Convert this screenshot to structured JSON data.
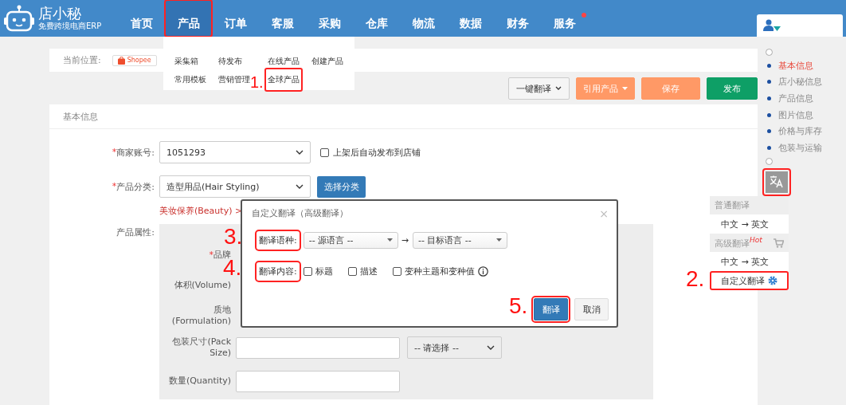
{
  "logo": {
    "name": "店小秘",
    "tagline": "免费跨境电商ERP"
  },
  "nav": [
    {
      "label": "首页",
      "selected": false,
      "highlighted": false,
      "badge": false
    },
    {
      "label": "产品",
      "selected": true,
      "highlighted": true,
      "badge": false
    },
    {
      "label": "订单",
      "selected": false,
      "highlighted": false,
      "badge": false
    },
    {
      "label": "客服",
      "selected": false,
      "highlighted": false,
      "badge": false
    },
    {
      "label": "采购",
      "selected": false,
      "highlighted": false,
      "badge": false
    },
    {
      "label": "仓库",
      "selected": false,
      "highlighted": false,
      "badge": false
    },
    {
      "label": "物流",
      "selected": false,
      "highlighted": false,
      "badge": false
    },
    {
      "label": "数据",
      "selected": false,
      "highlighted": false,
      "badge": false
    },
    {
      "label": "财务",
      "selected": false,
      "highlighted": false,
      "badge": false
    },
    {
      "label": "服务",
      "selected": false,
      "highlighted": false,
      "badge": true
    }
  ],
  "breadcrumb": {
    "label": "当前位置:",
    "platform": "Shopee"
  },
  "product_menu": {
    "rows": [
      [
        {
          "label": "采集箱",
          "highlighted": false
        },
        {
          "label": "待发布",
          "highlighted": false
        },
        {
          "label": "在线产品",
          "highlighted": false
        },
        {
          "label": "创建产品",
          "highlighted": false
        }
      ],
      [
        {
          "label": "常用模板",
          "highlighted": false
        },
        {
          "label": "营销管理",
          "highlighted": false
        },
        {
          "label": "全球产品",
          "highlighted": true
        }
      ]
    ]
  },
  "toolbar": [
    {
      "label": "一键翻译",
      "kind": "menu"
    },
    {
      "label": "引用产品",
      "kind": "orange-menu"
    },
    {
      "label": "保存",
      "kind": "orange"
    },
    {
      "label": "发布",
      "kind": "green"
    }
  ],
  "section": {
    "title": "基本信息"
  },
  "merchant_account": {
    "required_mark": "*",
    "label": "商家账号:",
    "value": "1051293",
    "auto_publish": {
      "label": "上架后自动发布到店铺",
      "checked": false
    }
  },
  "category": {
    "required_mark": "*",
    "label": "产品分类:",
    "value": "造型用品(Hair Styling)",
    "button": "选择分类",
    "path": "美妆保养(Beauty) >"
  },
  "attributes": {
    "label": "产品属性:",
    "rows": [
      {
        "required_mark": "*",
        "label": "品牌",
        "kind": "covered"
      },
      {
        "required_mark": "",
        "label": "体积(Volume)",
        "kind": "covered"
      },
      {
        "required_mark": "",
        "label": "质地 (Formulation)",
        "kind": "covered"
      },
      {
        "required_mark": "",
        "label": "包装尺寸(Pack Size)",
        "kind": "input-unit",
        "unit_placeholder": "-- 请选择 --"
      },
      {
        "required_mark": "",
        "label": "数量(Quantity)",
        "kind": "input"
      }
    ]
  },
  "anchor_nav": [
    {
      "label": "基本信息",
      "selected": true
    },
    {
      "label": "店小秘信息",
      "selected": false
    },
    {
      "label": "产品信息",
      "selected": false
    },
    {
      "label": "图片信息",
      "selected": false
    },
    {
      "label": "价格与库存",
      "selected": false
    },
    {
      "label": "包装与运输",
      "selected": false
    }
  ],
  "translate_button": {
    "highlighted": true
  },
  "translate_menu": [
    {
      "title": "普通翻译",
      "cart": false,
      "items": [
        {
          "label": "中文 → 英文",
          "settings": false,
          "highlighted": false
        }
      ]
    },
    {
      "title": "高级翻译",
      "hot": "Hot",
      "cart": true,
      "items": [
        {
          "label": "中文 → 英文",
          "settings": false,
          "highlighted": false
        },
        {
          "label": "自定义翻译",
          "settings": true,
          "highlighted": true
        }
      ]
    }
  ],
  "dialog": {
    "title": "自定义翻译（高级翻译）",
    "close": "×",
    "language": {
      "label": "翻译语种:",
      "highlighted": true,
      "source": "-- 源语言 --",
      "arrow": "→",
      "target": "-- 目标语言 --"
    },
    "content": {
      "label": "翻译内容:",
      "highlighted": true,
      "options": [
        {
          "label": "标题",
          "checked": false
        },
        {
          "label": "描述",
          "checked": false
        },
        {
          "label": "变种主题和变种值",
          "checked": false,
          "info": true
        }
      ]
    },
    "buttons": [
      {
        "label": "翻译",
        "kind": "primary",
        "highlighted": true
      },
      {
        "label": "取消",
        "kind": "default",
        "highlighted": false
      }
    ]
  },
  "step_marks": [
    "1.",
    "2.",
    "3.",
    "4.",
    "5."
  ]
}
